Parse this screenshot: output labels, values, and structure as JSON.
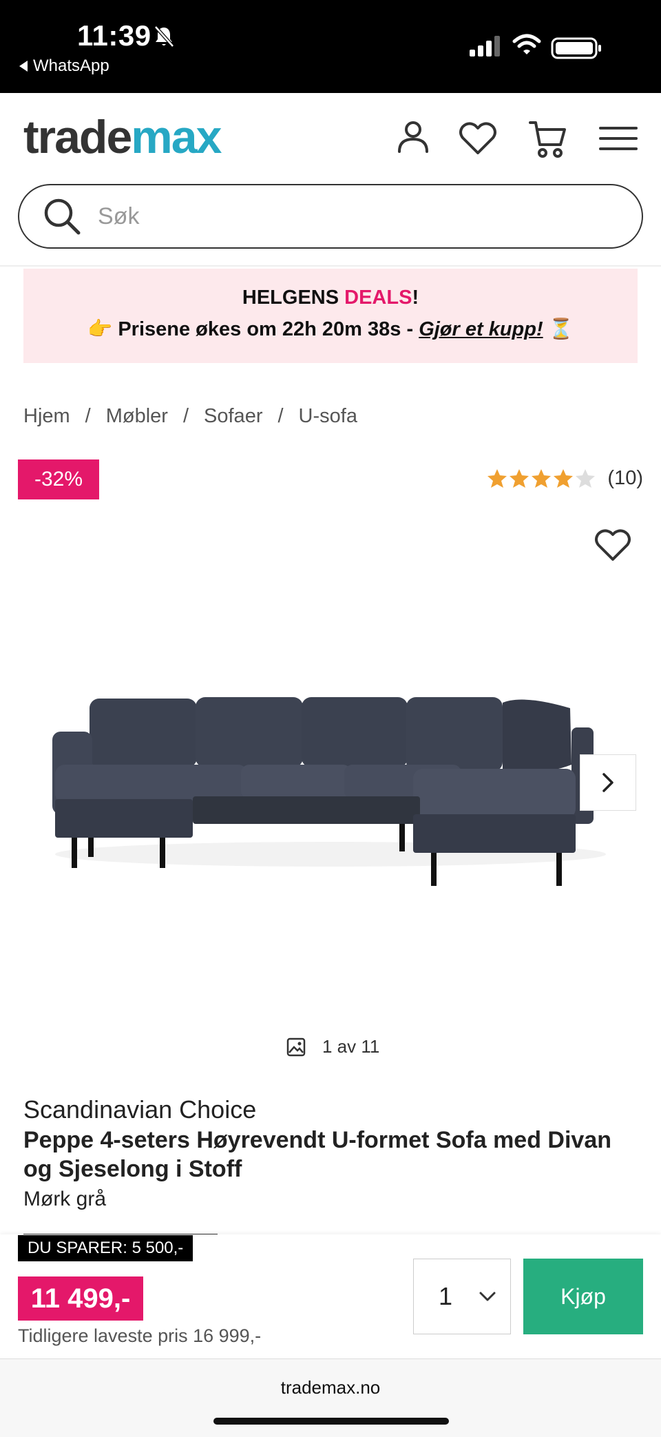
{
  "status_bar": {
    "time": "11:39",
    "back_app": "WhatsApp"
  },
  "header": {
    "logo_part1": "trade",
    "logo_part2": "max",
    "search_placeholder": "Søk",
    "icons": [
      "account-icon",
      "heart-icon",
      "cart-icon",
      "menu-icon"
    ]
  },
  "promo": {
    "line1_prefix": "HELGENS ",
    "line1_highlight": "DEALS",
    "line1_suffix": "!",
    "line2_emoji": "👉",
    "line2_text": "Prisene økes om 22h 20m 38s - ",
    "line2_link": "Gjør et kupp!",
    "line2_end_emoji": "⏳"
  },
  "breadcrumb": [
    "Hjem",
    "Møbler",
    "Sofaer",
    "U-sofa"
  ],
  "product": {
    "discount_badge": "-32%",
    "rating_value": 4.5,
    "rating_count": "(10)",
    "image_counter": "1 av 11",
    "brand": "Scandinavian Choice",
    "title": "Peppe 4-seters Høyrevendt U-formet Sofa med Divan og Sjeselong i Stoff",
    "color": "Mørk grå"
  },
  "buy_bar": {
    "savings": "DU SPARER: 5 500,-",
    "price": "11 499,-",
    "previous_lowest": "Tidligere laveste pris 16 999,-",
    "quantity": "1",
    "buy_label": "Kjøp"
  },
  "browser": {
    "url": "trademax.no"
  },
  "colors": {
    "brand_pink": "#e4186a",
    "brand_teal": "#27a8c4",
    "buy_green": "#27ae7f",
    "promo_bg": "#fde9ec",
    "star": "#f0a030"
  }
}
